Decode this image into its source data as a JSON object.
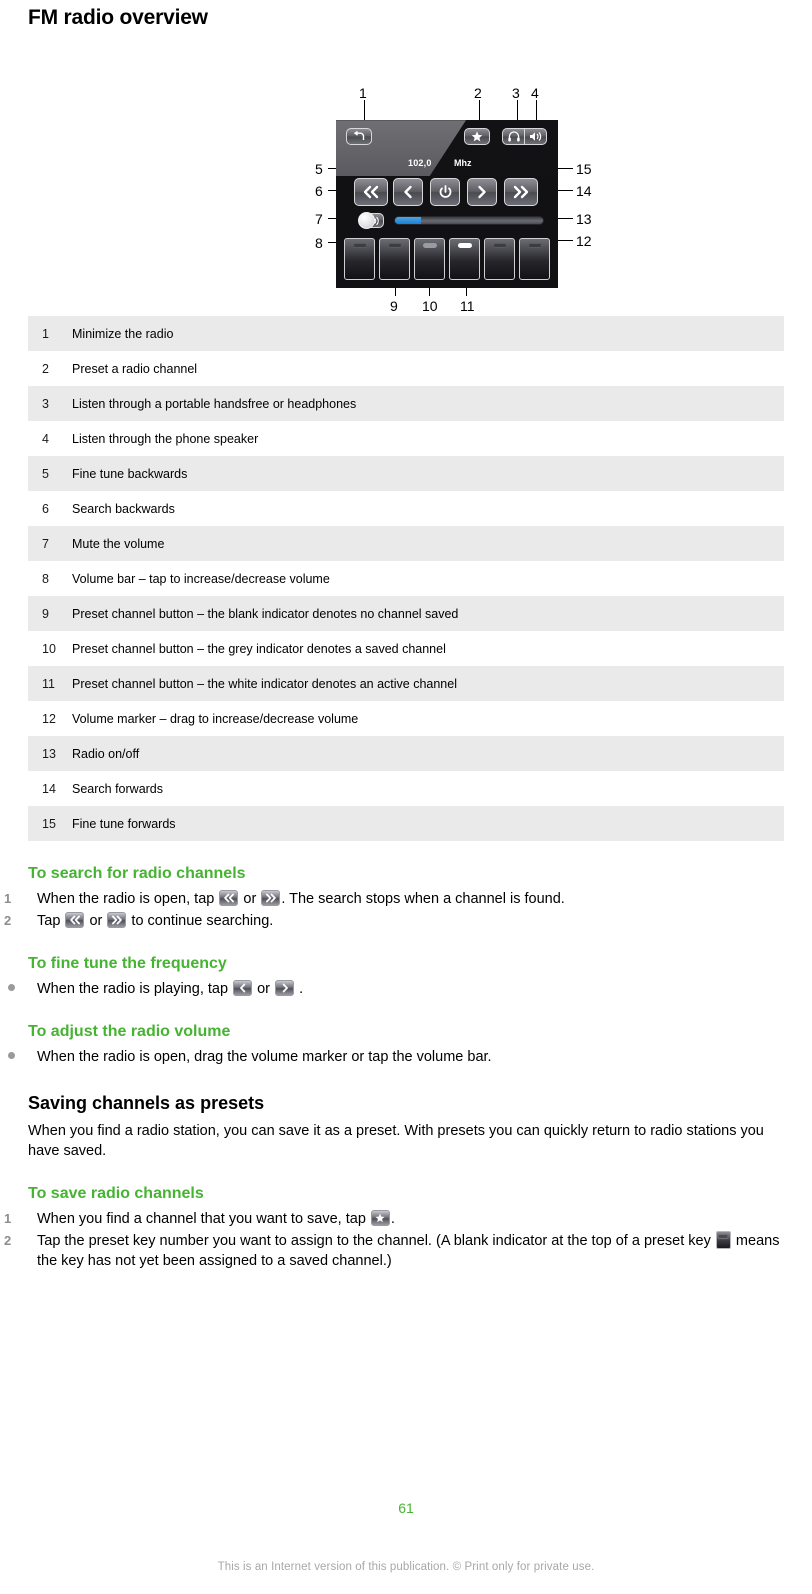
{
  "page_title": "FM radio overview",
  "figure": {
    "frequency": "102,0",
    "frequency_unit": "Mhz",
    "callouts": [
      "1",
      "2",
      "3",
      "4",
      "5",
      "6",
      "7",
      "8",
      "9",
      "10",
      "11",
      "12",
      "13",
      "14",
      "15"
    ],
    "buttons": {
      "back": "back-icon",
      "preset_star": "star-icon",
      "headphones": "headphones-icon",
      "speaker": "speaker-icon",
      "search_backwards": "double-chevron-left-icon",
      "fine_tune_backwards": "chevron-left-icon",
      "power": "power-icon",
      "fine_tune_forwards": "chevron-right-icon",
      "search_forwards": "double-chevron-right-icon",
      "mute": "mute-speaker-icon"
    },
    "preset_indicators": [
      "blank",
      "blank",
      "grey",
      "white",
      "blank",
      "blank"
    ]
  },
  "table": {
    "rows": [
      {
        "num": "1",
        "desc": "Minimize the radio"
      },
      {
        "num": "2",
        "desc": "Preset a radio channel"
      },
      {
        "num": "3",
        "desc": "Listen through a portable handsfree or headphones"
      },
      {
        "num": "4",
        "desc": "Listen through the phone speaker"
      },
      {
        "num": "5",
        "desc": "Fine tune backwards"
      },
      {
        "num": "6",
        "desc": "Search backwards"
      },
      {
        "num": "7",
        "desc": "Mute the volume"
      },
      {
        "num": "8",
        "desc": "Volume bar – tap to increase/decrease volume"
      },
      {
        "num": "9",
        "desc": "Preset channel button – the blank indicator denotes no channel saved"
      },
      {
        "num": "10",
        "desc": "Preset channel button – the grey indicator denotes a saved channel"
      },
      {
        "num": "11",
        "desc": "Preset channel button – the white indicator denotes an active channel"
      },
      {
        "num": "12",
        "desc": "Volume marker – drag to increase/decrease volume"
      },
      {
        "num": "13",
        "desc": "Radio on/off"
      },
      {
        "num": "14",
        "desc": "Search forwards"
      },
      {
        "num": "15",
        "desc": "Fine tune forwards"
      }
    ]
  },
  "sections": {
    "search": {
      "heading": "To search for radio channels",
      "step1_a": "When the radio is open, tap",
      "step1_or": "or",
      "step1_b": ". The search stops when a channel is found.",
      "step2_a": "Tap",
      "step2_or": "or",
      "step2_b": "to continue searching.",
      "marker1": "1",
      "marker2": "2"
    },
    "finetune": {
      "heading": "To fine tune the frequency",
      "text_a": "When the radio is playing, tap",
      "text_or": "or",
      "text_b": "."
    },
    "volume": {
      "heading": "To adjust the radio volume",
      "text": "When the radio is open, drag the volume marker or tap the volume bar."
    },
    "presets": {
      "heading": "Saving channels as presets",
      "text": "When you find a radio station, you can save it as a preset. With presets you can quickly return to radio stations you have saved."
    },
    "save": {
      "heading": "To save radio channels",
      "step1_a": "When you find a channel that you want to save, tap",
      "step1_b": ".",
      "step2_a": "Tap the preset key number you want to assign to the channel. (A blank indicator at the top of a preset key",
      "step2_b": "means the key has not yet been assigned to a saved channel.)",
      "marker1": "1",
      "marker2": "2"
    }
  },
  "footer": {
    "page_number": "61",
    "note": "This is an Internet version of this publication. © Print only for private use."
  },
  "colors": {
    "accent_green": "#46b332",
    "table_alt_row": "#eaeaea",
    "volume_fill": "#2f8ed8"
  }
}
